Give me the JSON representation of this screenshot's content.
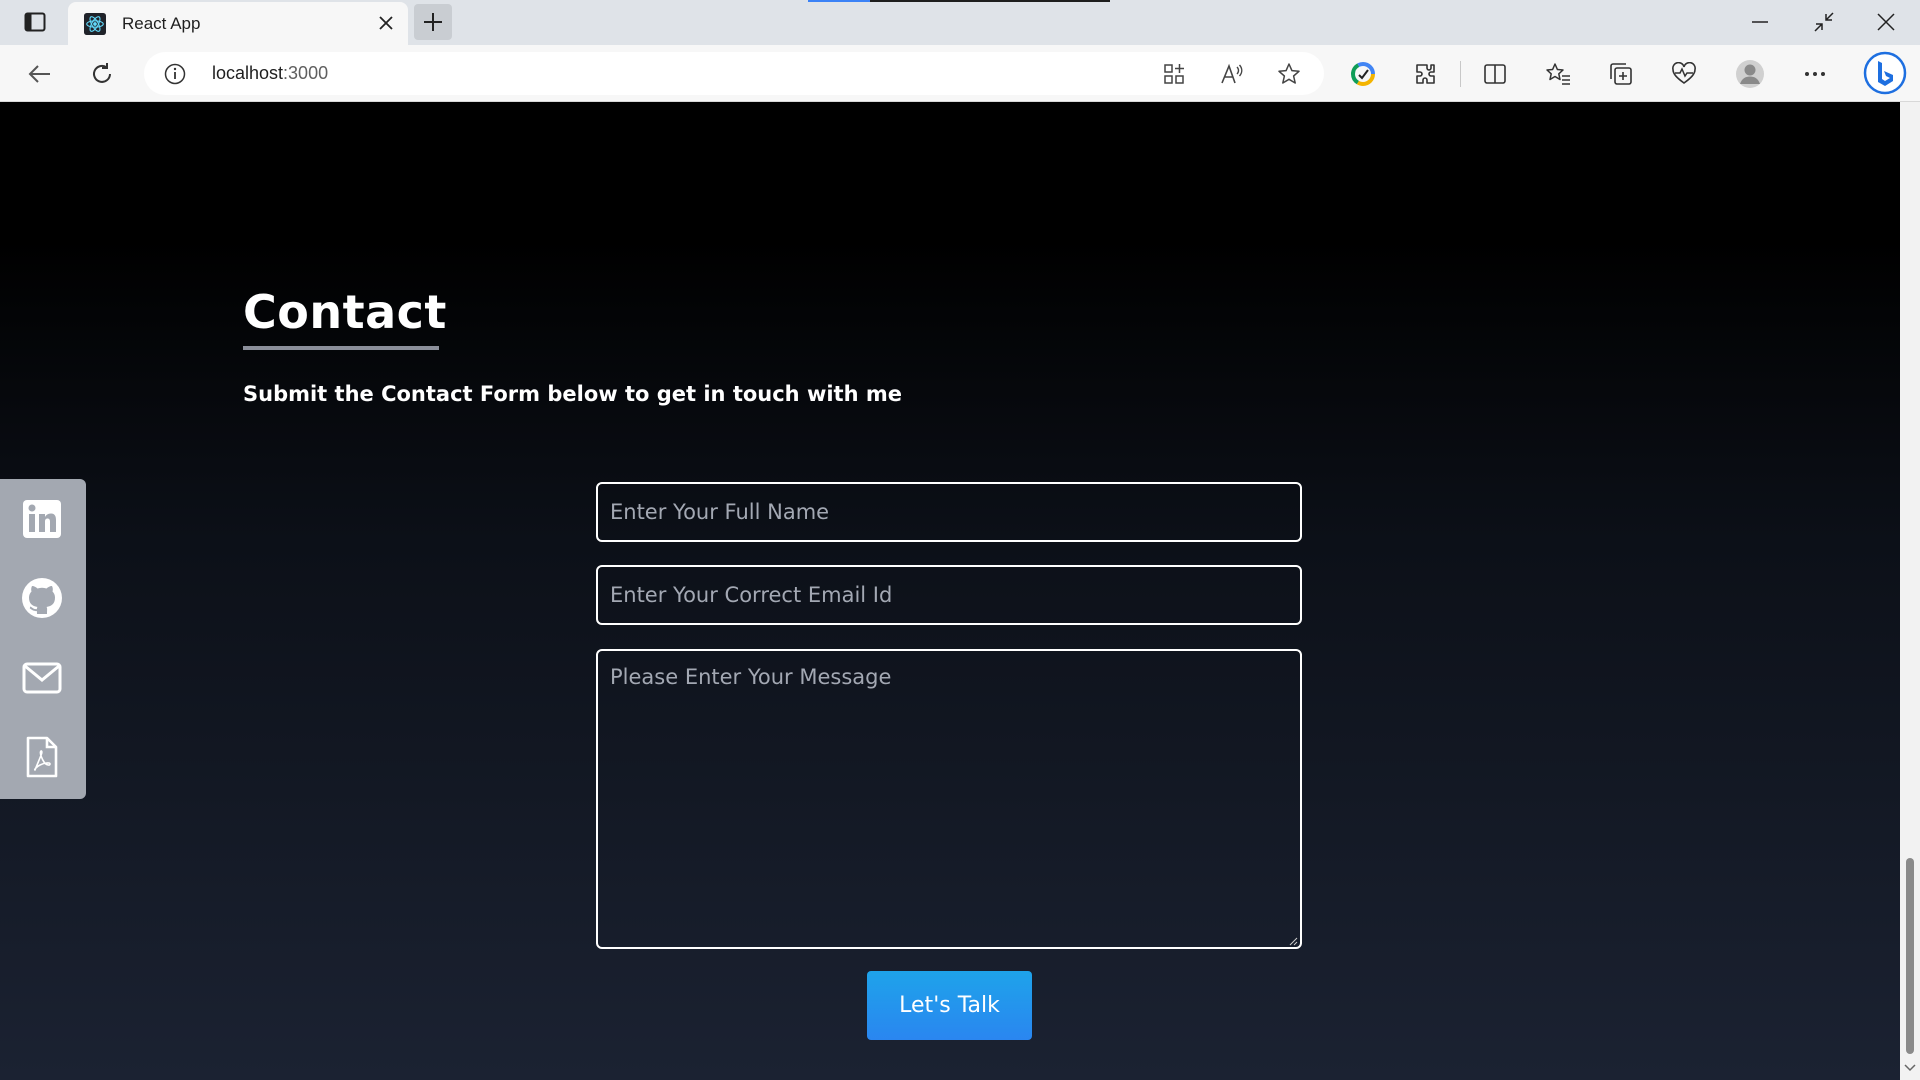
{
  "browser": {
    "tab_title": "React App",
    "url_host": "localhost",
    "url_port": ":3000"
  },
  "icons": {
    "tab_actions": "tab-actions-icon",
    "favicon": "react-icon",
    "tab_close": "close-icon",
    "new_tab": "plus-icon",
    "back": "back-arrow-icon",
    "refresh": "refresh-icon",
    "site_info": "info-icon",
    "app_available": "app-grid-icon",
    "read_aloud": "read-aloud-icon",
    "favorite": "star-icon",
    "extension_colorful": "extension-circle-icon",
    "extensions": "puzzle-icon",
    "split_screen": "split-screen-icon",
    "favorites": "favorites-icon",
    "collections": "collections-icon",
    "browser_essentials": "heart-pulse-icon",
    "profile": "profile-icon",
    "more": "more-icon",
    "copilot": "bing-icon",
    "linkedin": "linkedin-icon",
    "github": "github-icon",
    "email": "mail-icon",
    "resume": "pdf-icon"
  },
  "contact": {
    "heading": "Contact",
    "subtitle": "Submit the Contact Form below to get in touch with me",
    "name_placeholder": "Enter Your Full Name",
    "email_placeholder": "Enter Your Correct Email Id",
    "message_placeholder": "Please Enter Your Message",
    "submit_label": "Let's Talk"
  },
  "colors": {
    "accent": "#2a86f0",
    "sidebar": "#a3a8b1"
  }
}
